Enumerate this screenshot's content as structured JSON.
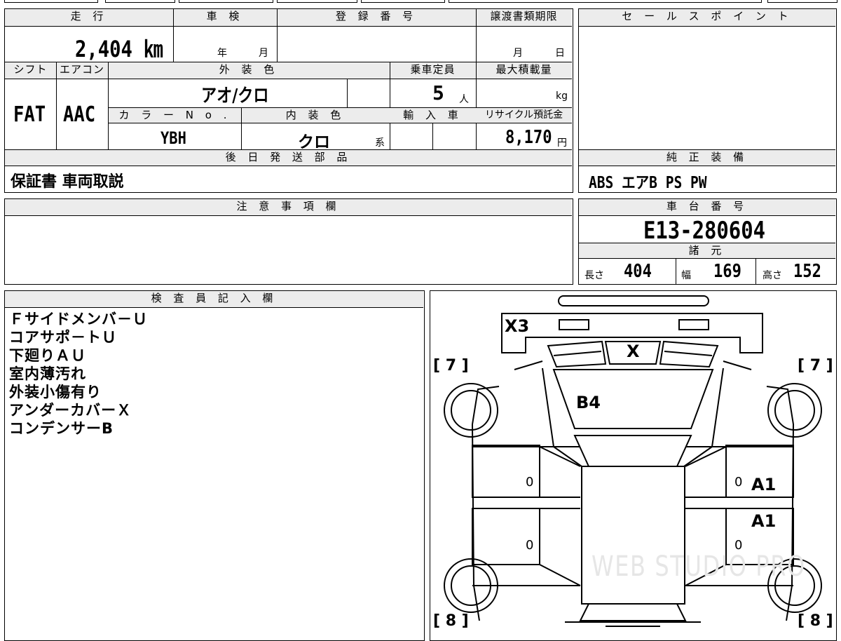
{
  "top": {
    "headers": {
      "mileage": "走 行",
      "inspection": "車 検",
      "registration": "登 録 番 号",
      "transfer_deadline": "譲渡書類期限",
      "sales_point": "セ ー ル ス ポ イ ン ト"
    },
    "mileage_value": "2,404 ㎞",
    "inspection_year_unit": "年",
    "inspection_month_unit": "月",
    "transfer_month_unit": "月",
    "transfer_day_unit": "日"
  },
  "specs": {
    "headers": {
      "shift": "シフト",
      "aircon": "エアコン",
      "exterior_color": "外 装 色",
      "capacity": "乗車定員",
      "max_load": "最大積載量",
      "color_no": "カ ラ ー N o .",
      "interior_color": "内 装 色",
      "import": "輸 入 車",
      "recycle": "リサイクル預託金"
    },
    "shift_value": "FAT",
    "aircon_value": "AAC",
    "exterior_color_value": "アオ/クロ",
    "capacity_value": "5",
    "capacity_unit": "人",
    "max_load_unit": "kg",
    "color_no_value": "YBH",
    "interior_color_value": "クロ",
    "interior_color_suffix": "系",
    "recycle_value": "8,170",
    "recycle_unit": "円"
  },
  "later_parts": {
    "header": "後 日 発 送 部 品",
    "value": "保証書 車両取説"
  },
  "genuine_equipment": {
    "header": "純 正 装 備",
    "value": "ABS エアB PS PW"
  },
  "notes": {
    "header": "注 意 事 項 欄"
  },
  "chassis": {
    "header": "車 台 番 号",
    "value": "E13-280604",
    "dimensions_header": "諸 元",
    "length_label": "長さ",
    "length_value": "404",
    "width_label": "幅",
    "width_value": "169",
    "height_label": "高さ",
    "height_value": "152"
  },
  "inspector": {
    "header": "検 査 員 記 入 欄",
    "lines": [
      "Ｆサイドメンバ－Ｕ",
      "コアサポ－トＵ",
      "下廻りＡＵ",
      "室内薄汚れ",
      "外装小傷有り",
      "アンダーカバーＸ",
      "コンデンサーB"
    ]
  },
  "diagram": {
    "marks": {
      "front_bumper": "X3",
      "grille": "X",
      "hood": "B4",
      "right_front_door": "A1",
      "right_rear_door": "A1",
      "left_front_door_zero": "0",
      "left_rear_door_zero": "0",
      "right_front_door_zero": "0",
      "right_rear_door_zero": "0"
    },
    "tires": {
      "front_left": "[ 7 ]",
      "front_right": "[ 7 ]",
      "rear_left": "[ 8 ]",
      "rear_right": "[ 8 ]"
    },
    "watermark": "WEB STUDIO PRO"
  }
}
